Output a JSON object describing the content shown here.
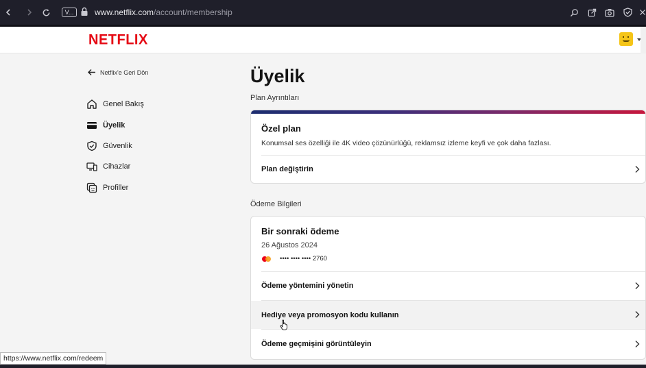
{
  "browser": {
    "tab_chip": "V...",
    "url_host": "www.netflix.com",
    "url_path": "/account/membership",
    "icons": [
      "back-icon",
      "forward-icon",
      "reload-icon",
      "lock-icon",
      "search-icon",
      "share-icon",
      "camera-icon",
      "shield-icon",
      "extension-icon"
    ]
  },
  "header": {
    "logo": "NETFLIX"
  },
  "sidebar": {
    "back_label": "Netflix'e Geri Dön",
    "items": [
      {
        "label": "Genel Bakış",
        "icon": "home-icon"
      },
      {
        "label": "Üyelik",
        "icon": "card-icon",
        "active": true
      },
      {
        "label": "Güvenlik",
        "icon": "shield-icon"
      },
      {
        "label": "Cihazlar",
        "icon": "devices-icon"
      },
      {
        "label": "Profiller",
        "icon": "profiles-icon"
      }
    ]
  },
  "main": {
    "title": "Üyelik",
    "plan_section_label": "Plan Ayrıntıları",
    "plan": {
      "name": "Özel plan",
      "description": "Konumsal ses özelliği ile 4K video çözünürlüğü, reklamsız izleme keyfi ve çok daha fazlası.",
      "change_label": "Plan değiştirin"
    },
    "payment_section_label": "Ödeme Bilgileri",
    "payment": {
      "next_label": "Bir sonraki ödeme",
      "date": "26 Ağustos 2024",
      "card_masked": "•••• •••• •••• 2760",
      "manage_label": "Ödeme yöntemini yönetin",
      "gift_label": "Hediye veya promosyon kodu kullanın",
      "history_label": "Ödeme geçmişini görüntüleyin"
    }
  },
  "status_bar": {
    "link_url": "https://www.netflix.com/redeem"
  },
  "colors": {
    "brand": "#e50914",
    "page_bg": "#f4f4f4",
    "chrome_bg": "#1f1f2a"
  }
}
